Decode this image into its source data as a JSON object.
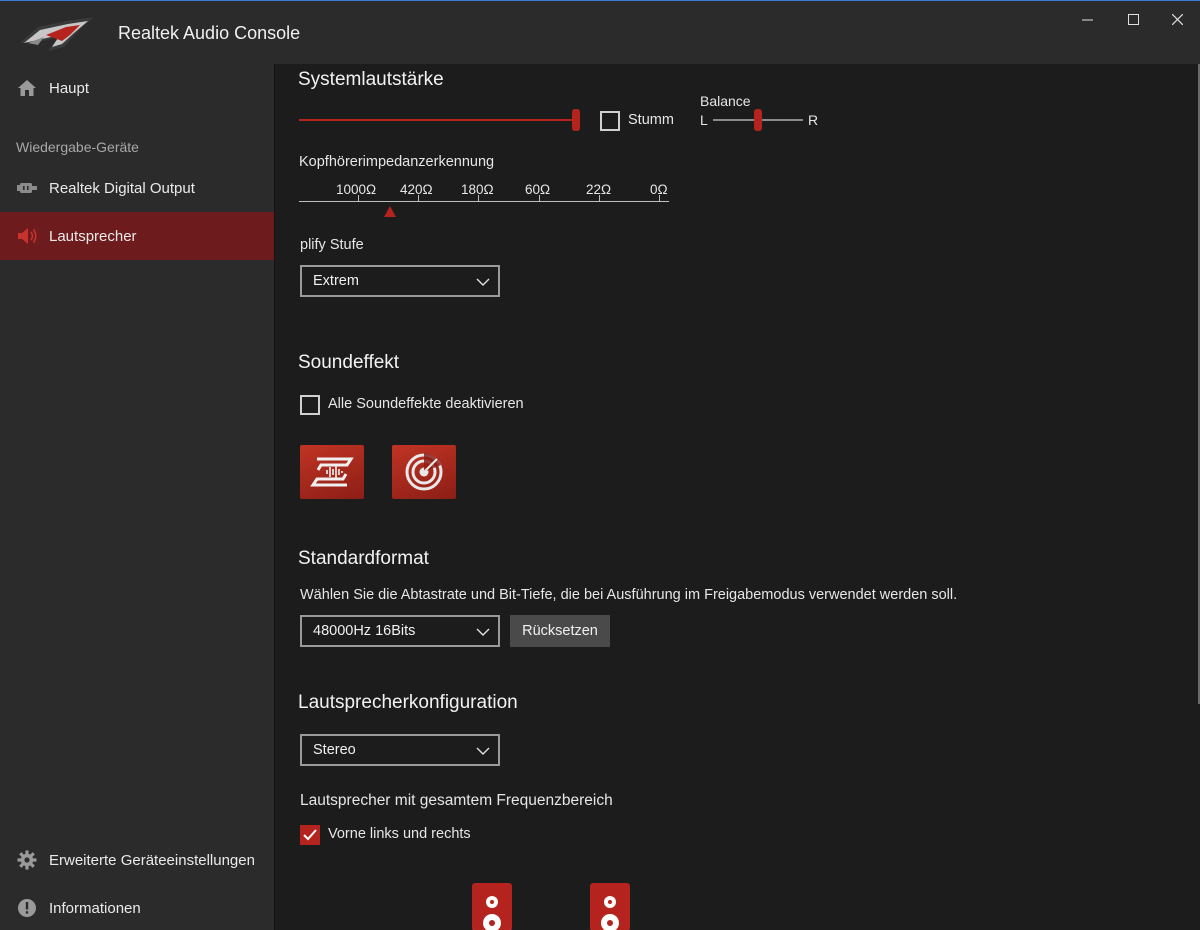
{
  "window": {
    "title": "Realtek Audio Console"
  },
  "sidebar": {
    "home_label": "Haupt",
    "section_label": "Wiedergabe-Geräte",
    "devices": [
      {
        "label": "Realtek Digital Output",
        "icon": "digital-output-icon"
      },
      {
        "label": "Lautsprecher",
        "icon": "speaker-icon",
        "active": true
      }
    ],
    "advanced_label": "Erweiterte Geräteeinstellungen",
    "info_label": "Informationen"
  },
  "volume": {
    "heading": "Systemlautstärke",
    "mute_label": "Stumm",
    "mute_checked": false,
    "level": 1.0,
    "balance_label": "Balance",
    "balance_left": "L",
    "balance_right": "R",
    "balance_value": 0.5
  },
  "impedance": {
    "label": "Kopfhörerimpedanzerkennung",
    "ticks": [
      "1000Ω",
      "420Ω",
      "180Ω",
      "60Ω",
      "22Ω",
      "0Ω"
    ]
  },
  "amplify": {
    "label": "plify Stufe",
    "selected": "Extrem"
  },
  "soundeffect": {
    "heading": "Soundeffekt",
    "disable_all_label": "Alle Soundeffekte deaktivieren",
    "disable_all_checked": false,
    "effects": [
      "sonic-studio-icon",
      "sonic-radar-icon"
    ]
  },
  "format": {
    "heading": "Standardformat",
    "description": "Wählen Sie die Abtastrate und Bit-Tiefe, die bei Ausführung im Freigabemodus verwendet werden soll.",
    "selected": "48000Hz 16Bits",
    "reset_label": "Rücksetzen"
  },
  "config": {
    "heading": "Lautsprecherkonfiguration",
    "selected": "Stereo",
    "fullrange_label": "Lautsprecher mit gesamtem Frequenzbereich",
    "front_label": "Vorne links und rechts",
    "front_checked": true
  },
  "colors": {
    "accent": "#b5231f",
    "active_nav": "#6e1b1d",
    "sidebar_bg": "#2b2b2b",
    "main_bg": "#1c1c1c"
  }
}
